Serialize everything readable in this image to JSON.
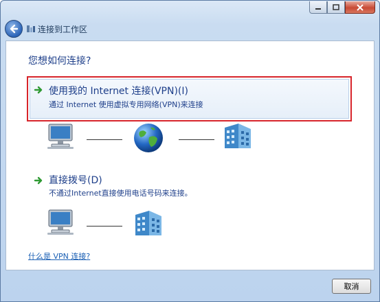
{
  "window": {
    "title": "连接到工作区",
    "controls": {
      "minimize_icon": "minimize-icon",
      "maximize_icon": "maximize-icon",
      "close_icon": "close-icon"
    }
  },
  "main": {
    "question": "您想如何连接?",
    "options": [
      {
        "title": "使用我的 Internet 连接(VPN)(I)",
        "description": "通过 Internet 使用虚拟专用网络(VPN)来连接",
        "selected": true,
        "diagram": [
          "computer-icon",
          "globe-icon",
          "building-icon"
        ]
      },
      {
        "title": "直接拨号(D)",
        "description": "不通过Internet直接使用电话号码来连接。",
        "selected": false,
        "diagram": [
          "computer-icon",
          "building-icon"
        ]
      }
    ],
    "help_link": "什么是 VPN 连接?"
  },
  "footer": {
    "cancel_label": "取消"
  },
  "colors": {
    "highlight_border": "#d7242a",
    "heading": "#1e3f8a",
    "link": "#1a5fb4"
  }
}
